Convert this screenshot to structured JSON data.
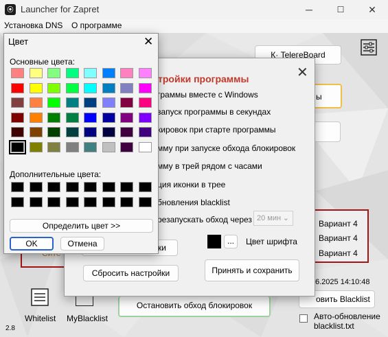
{
  "app": {
    "title": "Launcher for Zapret",
    "version": "2.8",
    "minimize": "─",
    "maximize": "☐",
    "close": "✕"
  },
  "menu": [
    "Установка DNS",
    "О программе"
  ],
  "main": {
    "top_button": "К· TeleгeBoard",
    "right_button_1": "ы",
    "variants": [
      "Вариант 4",
      "Вариант 4",
      "Вариант 4"
    ],
    "timestamp": "6.2025 14:10:48",
    "blacklist_button": "овить Blacklist",
    "stop_button": "Остановить обход блокировок",
    "auto_update_label": "Авто-обновление\nblacklist.txt",
    "whitelist_label": "Whitelist",
    "myblacklist_label": "MyBlacklist",
    "left_red_text": "Сите"
  },
  "settings": {
    "heading": "тройки программы",
    "options": [
      "граммы вместе с Windows",
      "запуск программы в секундах",
      "кировок при старте программы",
      "мму при запуске обхода блокировок",
      "мму в трей рядом с часами",
      "ция иконки в трее",
      "бновления blacklist",
      "резапускать обход через"
    ],
    "restart_interval": "20 мин",
    "font_color_label": "Цвет шрифта",
    "color_ellipsis": "...",
    "partial_button": "ки",
    "reset_button": "Сбросить настройки",
    "save_button": "Принять и сохранить",
    "close_glyph": "✕"
  },
  "color_dialog": {
    "title": "Цвет",
    "close_glyph": "✕",
    "basic_label": "Основные цвета:",
    "custom_label": "Дополнительные цвета:",
    "define_button": "Определить цвет >>",
    "ok_button": "OK",
    "cancel_button": "Отмена",
    "basic_colors": [
      [
        "#ff8080",
        "#ffff80",
        "#80ff80",
        "#00ff80",
        "#80ffff",
        "#0080ff",
        "#ff80c0",
        "#ff80ff"
      ],
      [
        "#ff0000",
        "#ffff00",
        "#80ff00",
        "#00ff40",
        "#00ffff",
        "#0080c0",
        "#8080c0",
        "#ff00ff"
      ],
      [
        "#804040",
        "#ff8040",
        "#00ff00",
        "#008080",
        "#004080",
        "#8080ff",
        "#800040",
        "#ff0080"
      ],
      [
        "#800000",
        "#ff8000",
        "#008000",
        "#008040",
        "#0000ff",
        "#0000a0",
        "#800080",
        "#8000ff"
      ],
      [
        "#400000",
        "#804000",
        "#004000",
        "#004040",
        "#000080",
        "#000040",
        "#400040",
        "#400080"
      ],
      [
        "#000000",
        "#808000",
        "#808040",
        "#808080",
        "#408080",
        "#c0c0c0",
        "#400040",
        "#ffffff"
      ]
    ],
    "selected_index": [
      5,
      0
    ]
  }
}
